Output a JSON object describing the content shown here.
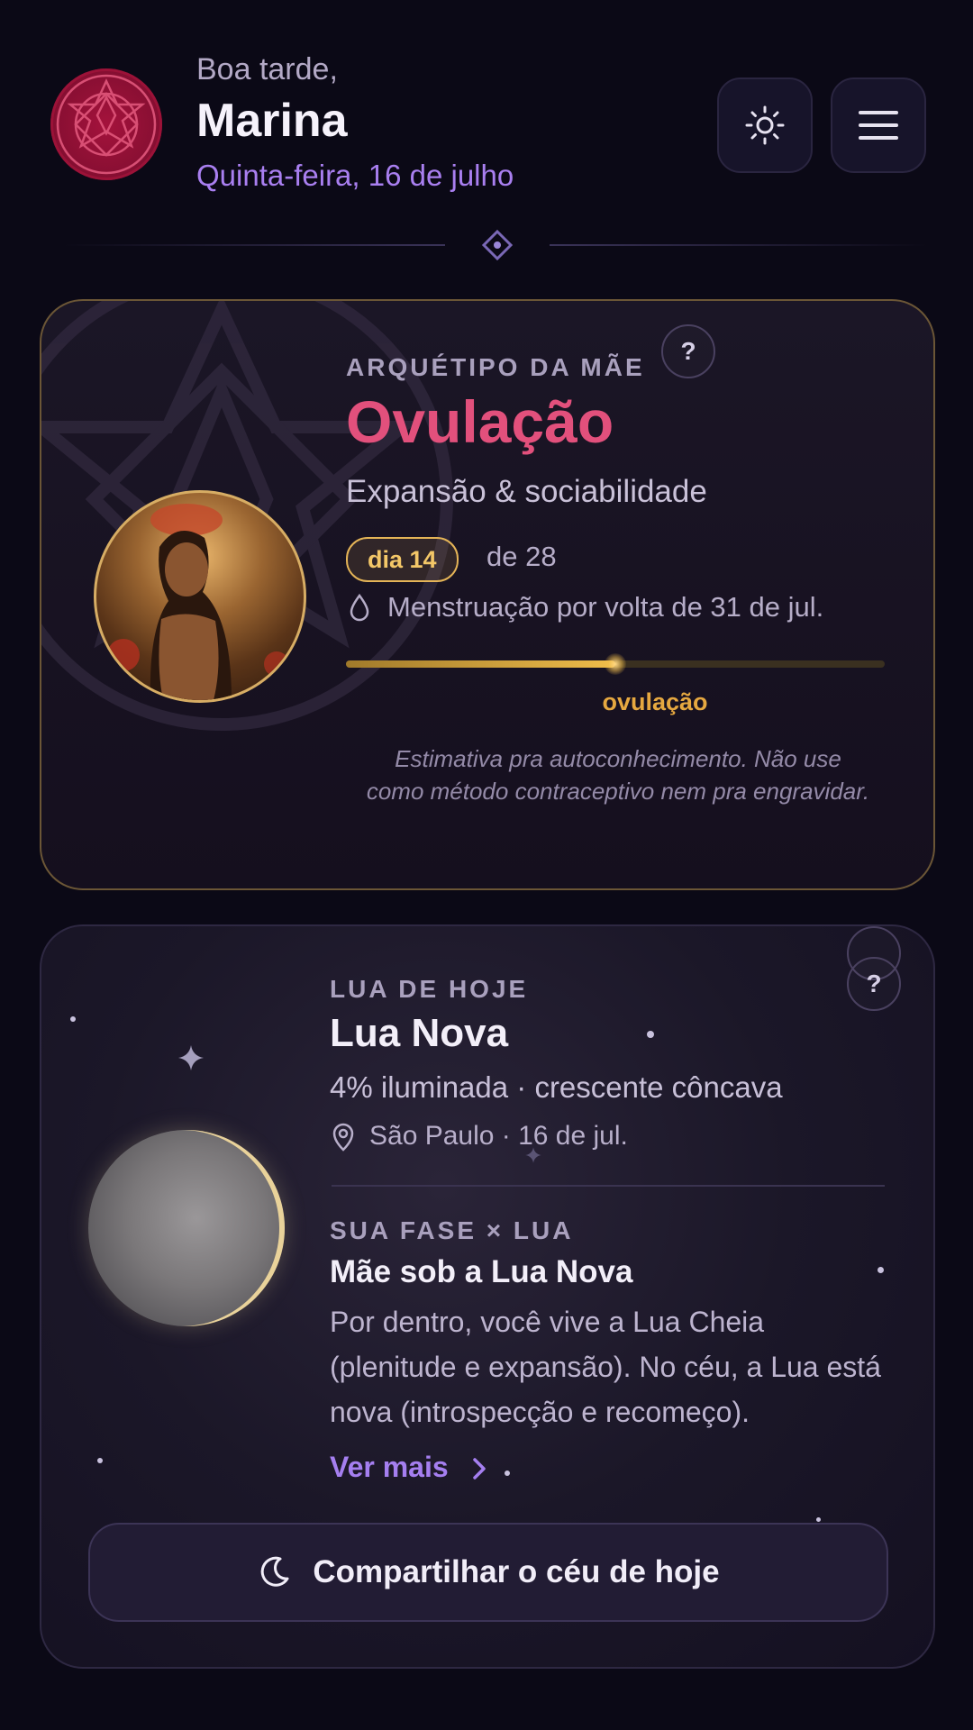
{
  "header": {
    "greeting": "Boa tarde,",
    "name": "Marina",
    "date": "Quinta-feira, 16 de julho",
    "theme_icon": "sun-icon",
    "menu_icon": "hamburger-menu-icon"
  },
  "cycle_card": {
    "kicker": "ARQUÉTIPO DA MÃE",
    "phase": "Ovulação",
    "subtitle": "Expansão & sociabilidade",
    "day_badge": "dia 14",
    "day_total": "de 28",
    "cycle_day": 14,
    "cycle_length": 28,
    "period_estimate": "Menstruação por volta de 31 de jul.",
    "progress_label": "ovulação",
    "progress_fraction": 0.5,
    "disclaimer": "Estimativa pra autoconhecimento. Não use como método contraceptivo nem pra engravidar.",
    "help_label": "?",
    "accent_color": "#e2507c",
    "gold_color": "#e4b457"
  },
  "moon_card": {
    "kicker": "LUA DE HOJE",
    "title": "Lua Nova",
    "subtitle": "4% iluminada · crescente côncava",
    "location": "São Paulo · 16 de jul.",
    "illumination_percent": 4,
    "help_label": "?",
    "combo_kicker": "SUA FASE × LUA",
    "combo_title": "Mãe sob a Lua Nova",
    "combo_body": "Por dentro, você vive a Lua Cheia (plenitude e expansão). No céu, a Lua está nova (introspecção e recomeço).",
    "more_label": "Ver mais",
    "share_label": "Compartilhar o céu de hoje",
    "share_icon": "crescent-moon-icon",
    "link_color": "#a57ff0"
  }
}
